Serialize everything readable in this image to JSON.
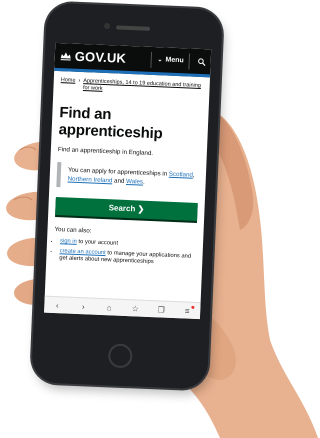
{
  "header": {
    "logo": "GOV.UK",
    "menu_label": "Menu"
  },
  "breadcrumb": {
    "home": "Home",
    "current": "Apprenticeships, 14 to 19 education and training for work"
  },
  "main": {
    "title": "Find an apprenticeship",
    "lead": "Find an apprenticeship in England.",
    "inset_text": "You can apply for apprenticeships in",
    "inset_link_1": "Scotland",
    "inset_sep": ",",
    "inset_link_2": "Northern Ireland",
    "inset_and": "and",
    "inset_link_3": "Wales",
    "inset_end": ".",
    "search_button": "Search"
  },
  "also": {
    "heading": "You can also:",
    "item1_link": "sign in",
    "item1_rest": "to your account",
    "item2_link": "create an account",
    "item2_rest": "to manage your applications and get alerts about new apprenticeships"
  },
  "colors": {
    "header_bg": "#0b0c0c",
    "accent_blue": "#1d70b8",
    "button_green": "#00703c"
  }
}
